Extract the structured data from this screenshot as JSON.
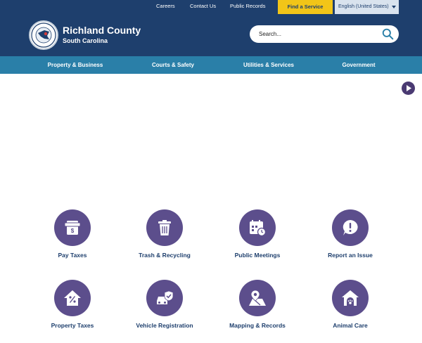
{
  "utility_nav": {
    "links": [
      "Careers",
      "Contact Us",
      "Public Records"
    ],
    "find_service": "Find a Service",
    "language": "English (United States)"
  },
  "header": {
    "title": "Richland County",
    "subtitle": "South Carolina",
    "search_placeholder": "Search..."
  },
  "main_nav": [
    "Property & Business",
    "Courts & Safety",
    "Utilities & Services",
    "Government"
  ],
  "quick_links": [
    {
      "label": "Pay Taxes",
      "icon": "bill-icon"
    },
    {
      "label": "Trash & Recycling",
      "icon": "trash-can-icon"
    },
    {
      "label": "Public Meetings",
      "icon": "calendar-clock-icon"
    },
    {
      "label": "Report an Issue",
      "icon": "alert-bubble-icon"
    },
    {
      "label": "Property Taxes",
      "icon": "house-percent-icon"
    },
    {
      "label": "Vehicle Registration",
      "icon": "car-check-icon"
    },
    {
      "label": "Mapping & Records",
      "icon": "map-pin-icon"
    },
    {
      "label": "Animal Care",
      "icon": "paw-house-icon"
    }
  ],
  "colors": {
    "navy": "#1e3f6d",
    "nav_blue": "#2a7fa8",
    "gold": "#f2c518",
    "purple": "#5c4e8c"
  }
}
